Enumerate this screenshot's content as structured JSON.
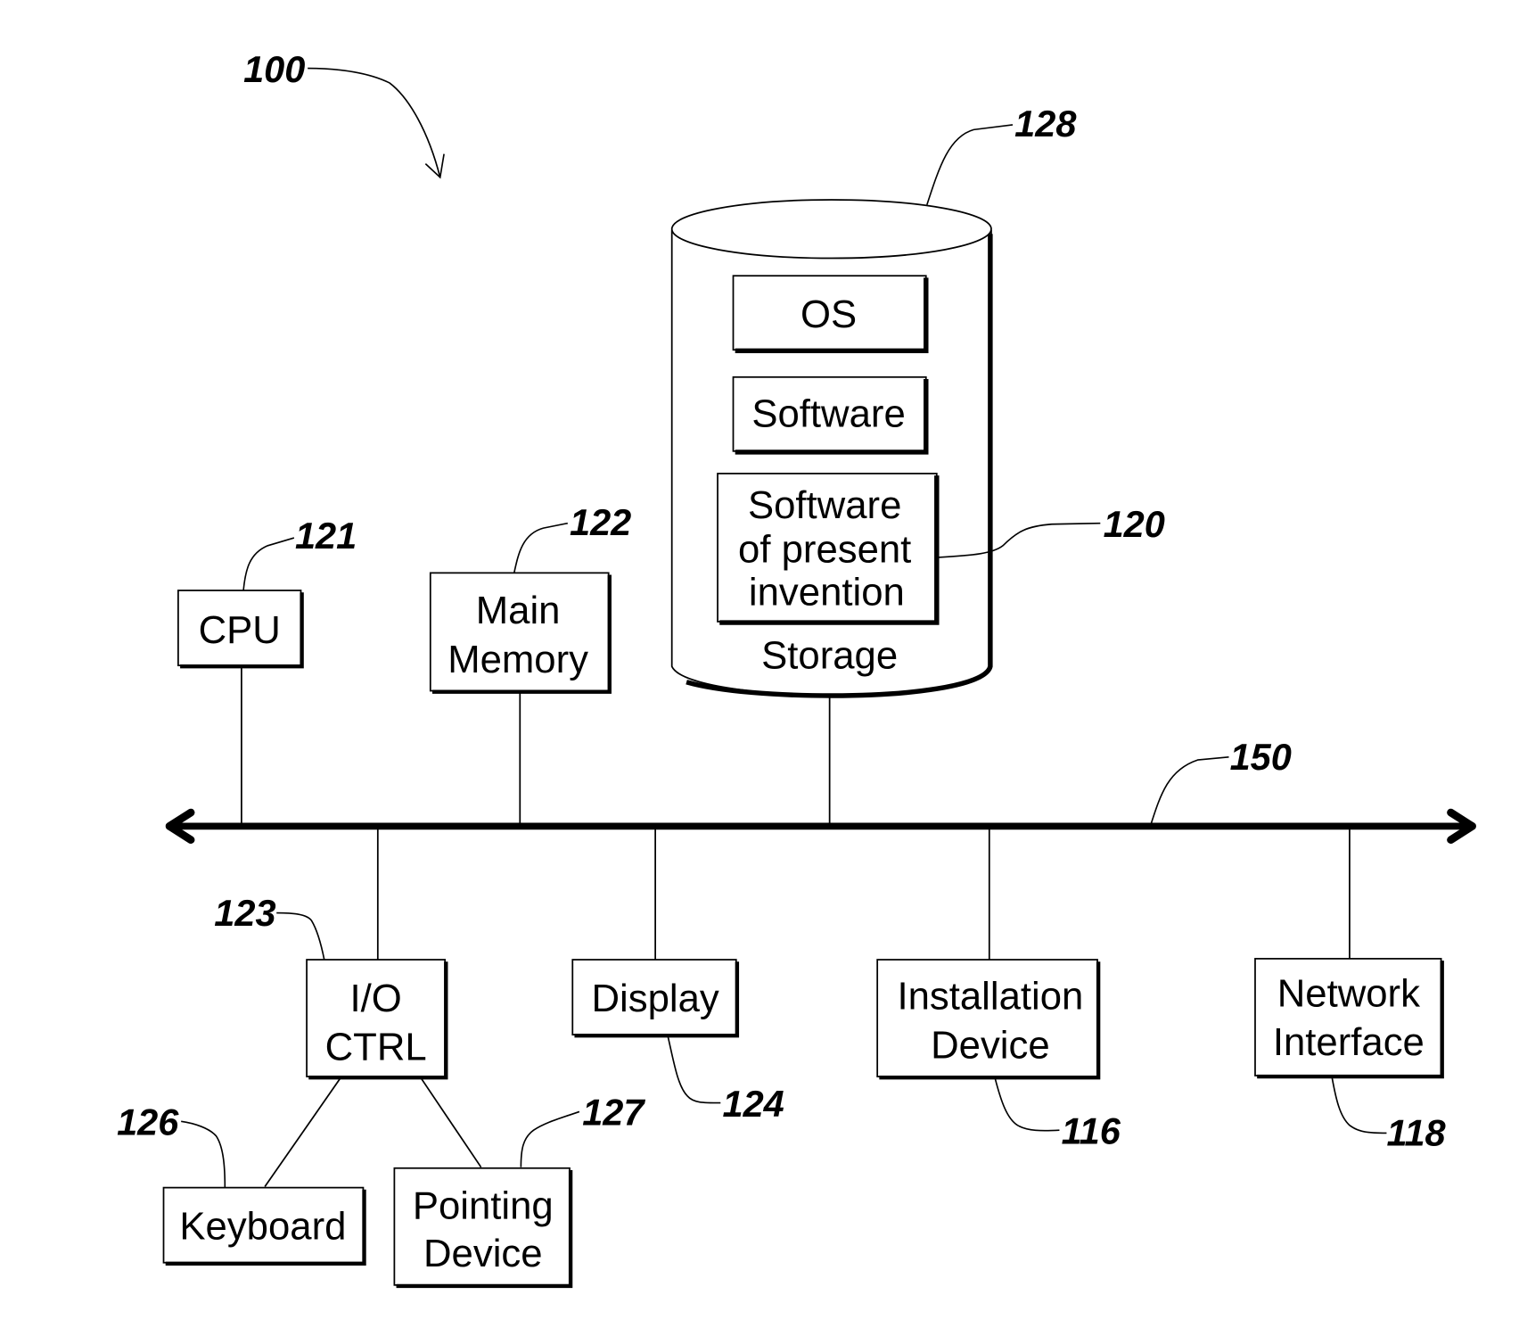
{
  "figure": {
    "ref": "100",
    "bus_ref": "150"
  },
  "storage": {
    "ref": "128",
    "label": "Storage",
    "items": [
      {
        "id": "os",
        "lines": [
          "OS"
        ]
      },
      {
        "id": "software",
        "lines": [
          "Software"
        ]
      },
      {
        "id": "software-invention",
        "ref": "120",
        "lines": [
          "Software",
          "of present",
          "invention"
        ]
      }
    ]
  },
  "components": {
    "cpu": {
      "ref": "121",
      "lines": [
        "CPU"
      ]
    },
    "main_memory": {
      "ref": "122",
      "lines": [
        "Main",
        "Memory"
      ]
    },
    "io_ctrl": {
      "ref": "123",
      "lines": [
        "I/O",
        "CTRL"
      ]
    },
    "display": {
      "ref": "124",
      "lines": [
        "Display"
      ]
    },
    "installation_device": {
      "ref": "116",
      "lines": [
        "Installation",
        "Device"
      ]
    },
    "network_interface": {
      "ref": "118",
      "lines": [
        "Network",
        "Interface"
      ]
    },
    "keyboard": {
      "ref": "126",
      "lines": [
        "Keyboard"
      ]
    },
    "pointing_device": {
      "ref": "127",
      "lines": [
        "Pointing",
        "Device"
      ]
    }
  }
}
